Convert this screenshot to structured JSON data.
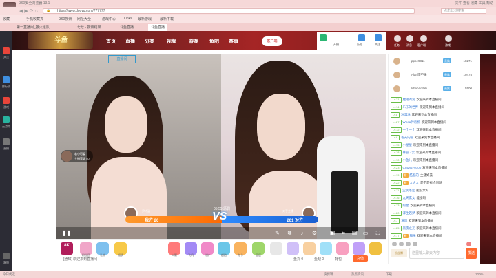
{
  "browser": {
    "title": "360安全浏览器 13.1",
    "controls": "文件  查看  收藏  工具  帮助",
    "url_prefix": "https://",
    "url": "www.douyu.com/777777",
    "search_placeholder": "点击此处搜索",
    "bookmarks": [
      "收藏",
      "手机收藏夹",
      "360搜索",
      "网址大全",
      "游戏中心",
      "Links",
      "最新游戏",
      "最新下载"
    ],
    "tabs": [
      "第一直播间_撒火组队...",
      "七七 - 搜索结果",
      "斗鱼直播",
      "斗鱼直播"
    ]
  },
  "site": {
    "banner_text": "斗鱼",
    "nav_items": [
      "首页",
      "直播",
      "分类",
      "视频",
      "游戏",
      "鱼吧",
      "赛事"
    ],
    "download_label": "客户端",
    "nav_right_labels": [
      "开播",
      "历史",
      "关注"
    ],
    "header_labels": [
      "任务",
      "消息",
      "客户端",
      "游戏"
    ]
  },
  "left_rail": {
    "items": [
      "关注",
      "排行榜",
      "游戏",
      "云游戏",
      "直播",
      "客服"
    ]
  },
  "player": {
    "room_label": "直播间",
    "left_tag_name": "若小可爱",
    "left_tag_sub": "主播等级 40",
    "pk": {
      "timer": "05:55",
      "timer_label": "惩罚",
      "vs": "VS",
      "left_name": "尹诗涵",
      "left_score": "我方 20",
      "right_name": "对手主播",
      "right_score": "201 对方"
    },
    "like_icon": "thumbs-up-icon"
  },
  "gifts": {
    "rank_chip": "8K",
    "items": [
      {
        "label": "粉丝团",
        "color": "#f0a6c8"
      },
      {
        "label": "礼物",
        "color": "#7ec0ee"
      },
      {
        "label": "福袋",
        "color": "#f7c948"
      },
      {
        "label": "火箭",
        "color": "#ff7a7a"
      },
      {
        "label": "飞机",
        "color": "#a38af5"
      },
      {
        "label": "守护",
        "color": "#f08ac8"
      },
      {
        "label": "超跑",
        "color": "#6bc6e8"
      },
      {
        "label": "办卡",
        "color": "#f9b35e"
      },
      {
        "label": "星辰",
        "color": "#9fd66a"
      }
    ],
    "bottom_notice": "[通知] 欢迎来到直播间",
    "bottom_items": [
      "鱼丸 0",
      "鱼翅 0",
      "背包"
    ],
    "recharge_label": "充值"
  },
  "chat": {
    "ranks": [
      {
        "name": "pppe9811",
        "badge": "贵族",
        "value": "18271"
      },
      {
        "name": "Alan雨不睡",
        "badge": "贵族",
        "value": "10475"
      },
      {
        "name": "littlebaoifelli",
        "badge": "贵族",
        "value": "5500"
      }
    ],
    "messages": [
      {
        "lv": "Lv.21",
        "name": "魔鬼的爱",
        "text": "欢迎来到本直播间"
      },
      {
        "lv": "Lv.14",
        "name": "乐乐的世界",
        "text": "欢迎来到本直播间"
      },
      {
        "lv": "Lv.8",
        "name": "冰淇淋",
        "text": "欢迎来到本直播间"
      },
      {
        "lv": "Lv.27",
        "name": "Whoa神奇机",
        "text": "欢迎来到本直播间"
      },
      {
        "lv": "Lv.12",
        "name": "一个一个",
        "text": "欢迎来到本直播间"
      },
      {
        "lv": "Lv.9",
        "name": "冬天的雪",
        "text": "欢迎来到本直播间"
      },
      {
        "lv": "Lv.15",
        "name": "小星星",
        "text": "欢迎来到本直播间"
      },
      {
        "lv": "Lv.18",
        "name": "慕容 · 云",
        "text": "欢迎来到本直播间"
      },
      {
        "lv": "Lv.10",
        "name": "小鱼儿",
        "text": "欢迎来到本直播间"
      },
      {
        "lv": "Lv.23",
        "name": "Crazy270700",
        "text": "欢迎来到本直播间"
      },
      {
        "lv": "Lv.19",
        "name": "酷酷的",
        "text": "主播好美"
      },
      {
        "lv": "Lv.22",
        "name": "大大大",
        "text": "是不是有点问题"
      },
      {
        "lv": "Lv.11",
        "name": "尘埃落定",
        "text": "能投票吗"
      },
      {
        "lv": "Lv.16",
        "name": "九天玄女",
        "text": "能投吗"
      },
      {
        "lv": "Lv.13",
        "name": "阿星",
        "text": "欢迎来到本直播间"
      },
      {
        "lv": "Lv.20",
        "name": "浮生若梦",
        "text": "欢迎来到本直播间"
      },
      {
        "lv": "Lv.7",
        "name": "清风",
        "text": "欢迎来到本直播间"
      },
      {
        "lv": "Lv.25",
        "name": "黑夜之光",
        "text": "欢迎来到本直播间"
      },
      {
        "lv": "Lv.17",
        "name": "猫咪",
        "text": "欢迎来到本直播间"
      },
      {
        "lv": "Lv.24",
        "name": "飞鸟",
        "text": "欢迎来到本直播间"
      },
      {
        "lv": "Lv.26",
        "name": "小太阳",
        "text": "冲上去"
      },
      {
        "lv": "Lv.28",
        "name": "大宝贝",
        "text": "欢迎来到本直播间"
      }
    ],
    "fans_label": "粉丝牌",
    "input_placeholder": "这里输入聊天内容",
    "send_label": "发送"
  },
  "status": {
    "left": "今日优选",
    "right_items": [
      "快剪辑",
      "热点资讯",
      "下载",
      "100%"
    ]
  }
}
